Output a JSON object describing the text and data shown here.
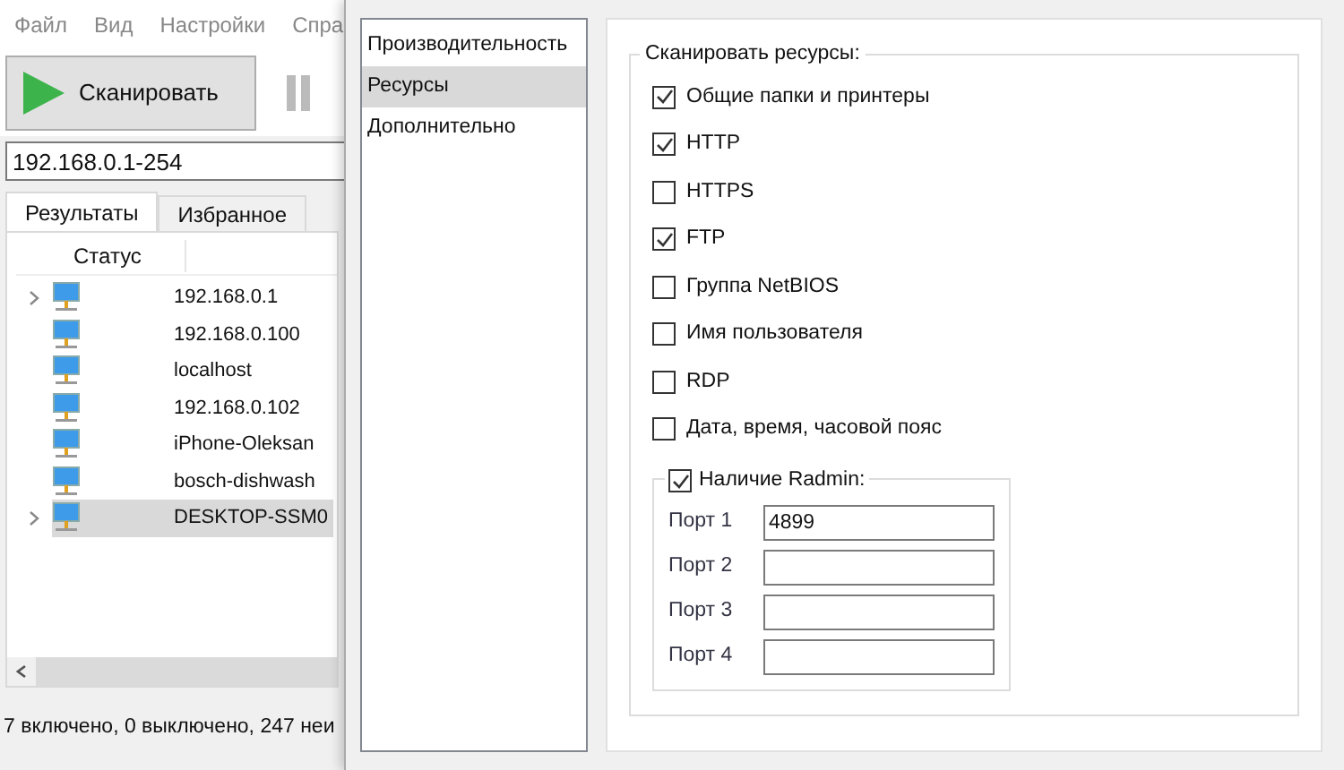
{
  "main_window": {
    "menu": [
      "Файл",
      "Вид",
      "Настройки",
      "Спра"
    ],
    "scan_button": {
      "label": "Сканировать"
    },
    "address": {
      "value": "192.168.0.1-254"
    },
    "tabs": [
      {
        "label": "Результаты",
        "selected": true
      },
      {
        "label": "Избранное",
        "selected": false
      }
    ],
    "table": {
      "columns": [
        "Статус"
      ],
      "rows": [
        {
          "name": "192.168.0.1",
          "expandable": true,
          "selected": false
        },
        {
          "name": "192.168.0.100",
          "expandable": false,
          "selected": false
        },
        {
          "name": "localhost",
          "expandable": false,
          "selected": false
        },
        {
          "name": "192.168.0.102",
          "expandable": false,
          "selected": false
        },
        {
          "name": "iPhone-Oleksan",
          "expandable": false,
          "selected": false
        },
        {
          "name": "bosch-dishwash",
          "expandable": false,
          "selected": false
        },
        {
          "name": "DESKTOP-SSM0",
          "expandable": true,
          "selected": true
        }
      ]
    },
    "status_bar": "7 включено, 0 выключено, 247 неи"
  },
  "settings": {
    "sidebar": [
      {
        "label": "Производительность",
        "selected": false
      },
      {
        "label": "Ресурсы",
        "selected": true
      },
      {
        "label": "Дополнительно",
        "selected": false
      }
    ],
    "group_title": "Сканировать ресурсы:",
    "options": [
      {
        "label": "Общие папки и принтеры",
        "checked": true
      },
      {
        "label": "HTTP",
        "checked": true
      },
      {
        "label": "HTTPS",
        "checked": false
      },
      {
        "label": "FTP",
        "checked": true
      },
      {
        "label": "Группа NetBIOS",
        "checked": false
      },
      {
        "label": "Имя пользователя",
        "checked": false
      },
      {
        "label": "RDP",
        "checked": false
      },
      {
        "label": "Дата, время, часовой пояс",
        "checked": false
      }
    ],
    "radmin": {
      "label": "Наличие Radmin:",
      "checked": true,
      "ports": [
        {
          "label": "Порт 1",
          "value": "4899"
        },
        {
          "label": "Порт 2"
        },
        {
          "label": "Порт 3"
        },
        {
          "label": "Порт 4"
        }
      ]
    }
  }
}
